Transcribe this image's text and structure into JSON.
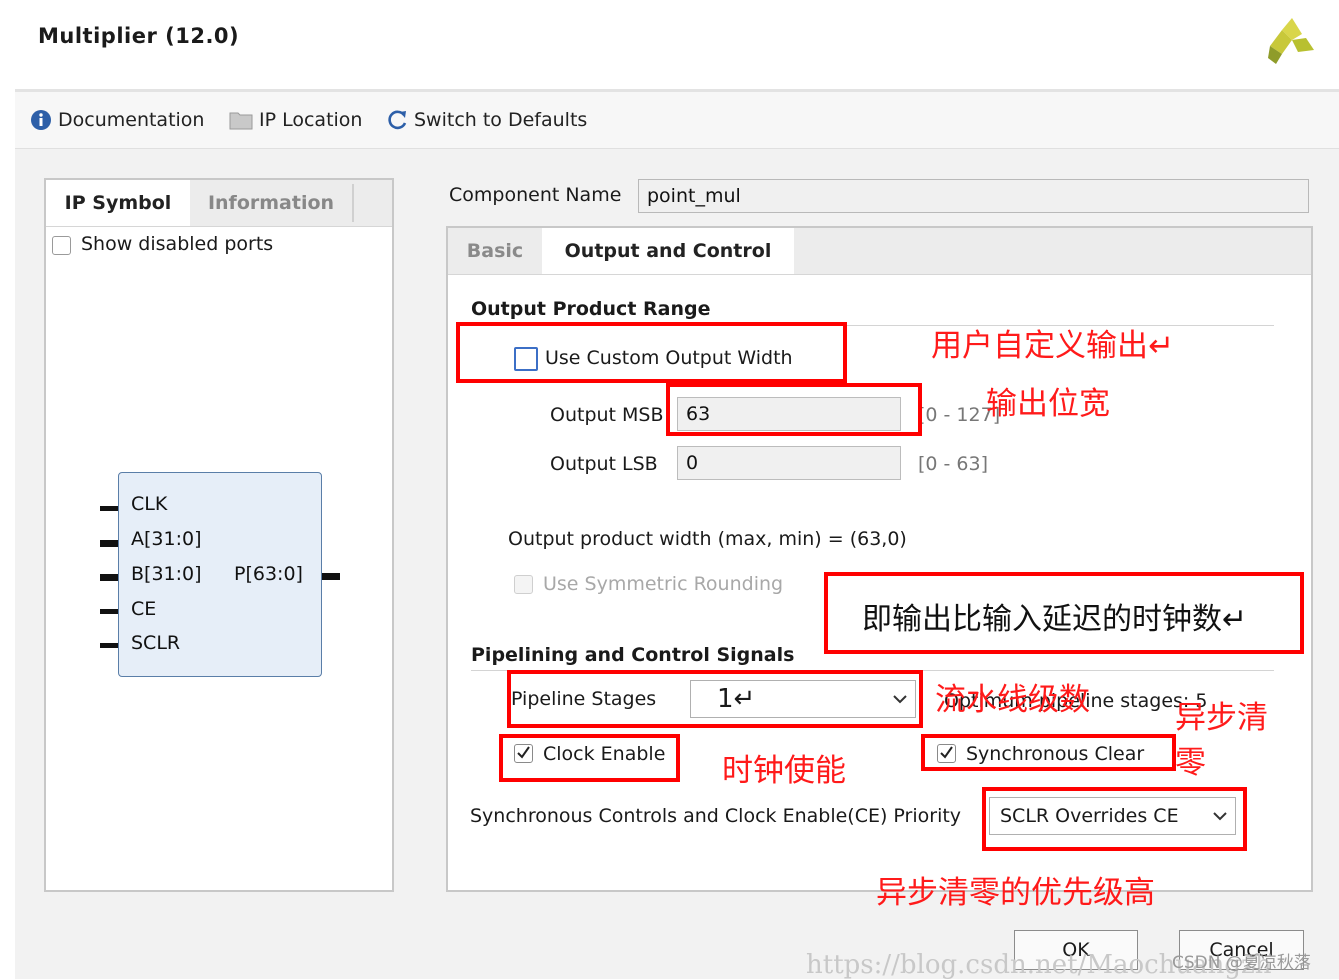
{
  "window": {
    "title": "Multiplier (12.0)"
  },
  "toolbar": {
    "documentation": "Documentation",
    "ip_location": "IP Location",
    "switch_defaults": "Switch to Defaults"
  },
  "left_panel": {
    "tabs": [
      "IP Symbol",
      "Information"
    ],
    "show_disabled_ports": "Show disabled ports",
    "symbol": {
      "inputs": [
        "CLK",
        "A[31:0]",
        "B[31:0]",
        "CE",
        "SCLR"
      ],
      "output": "P[63:0]"
    }
  },
  "component": {
    "label": "Component Name",
    "value": "point_mul"
  },
  "right_panel": {
    "tabs": [
      "Basic",
      "Output and Control"
    ],
    "output_range": {
      "title": "Output Product Range",
      "use_custom_width": "Use Custom Output Width",
      "msb_label": "Output MSB",
      "msb_value": "63",
      "msb_range": "[0 - 127]",
      "lsb_label": "Output LSB",
      "lsb_value": "0",
      "lsb_range": "[0 - 63]",
      "product_width": "Output product width (max, min) = (63,0)",
      "symmetric_rounding": "Use Symmetric Rounding"
    },
    "pipelining": {
      "title": "Pipelining and Control Signals",
      "stages_label": "Pipeline Stages",
      "stages_value": "1↵",
      "optimum": "Optimum pipeline stages: 5",
      "clock_enable": "Clock Enable",
      "sync_clear": "Synchronous Clear",
      "priority_label": "Synchronous Controls and Clock Enable(CE) Priority",
      "priority_value": "SCLR Overrides CE"
    }
  },
  "annotations": {
    "custom_output": "用户自定义输出↵",
    "output_width": "输出位宽",
    "latency_note": "即输出比输入延迟的时钟数↵",
    "pipeline_stages": "流水线级数",
    "clock_enable": "时钟使能",
    "sync_clear_1": "异步清",
    "sync_clear_2": "零",
    "priority": "异步清零的优先级高"
  },
  "buttons": {
    "ok": "OK",
    "cancel": "Cancel"
  },
  "watermarks": {
    "url": "https://blog.csdn.net/Maochuangzh",
    "csdn": "CSDN @夏凉秋落"
  },
  "colors": {
    "accent_red": "#ff0000",
    "checkbox_blue": "#3c6fc6",
    "symbol_fill": "#e6eef8"
  }
}
